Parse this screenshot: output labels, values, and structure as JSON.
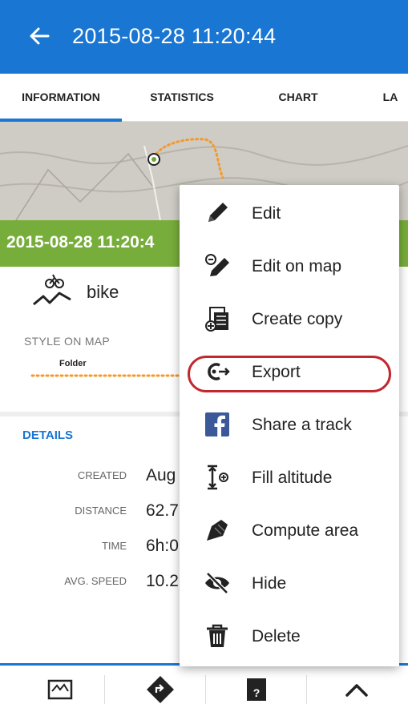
{
  "appbar": {
    "title": "2015-08-28 11:20:44"
  },
  "tabs": [
    {
      "label": "INFORMATION"
    },
    {
      "label": "STATISTICS"
    },
    {
      "label": "CHART"
    },
    {
      "label": "LA"
    }
  ],
  "track": {
    "name_banner": "2015-08-28 11:20:4"
  },
  "activity": {
    "label": "bike"
  },
  "style": {
    "label": "STYLE ON MAP",
    "folder": "Folder",
    "line_color": "#f39a2e"
  },
  "details": {
    "heading": "DETAILS",
    "rows": [
      {
        "key": "CREATED",
        "value": "Aug"
      },
      {
        "key": "DISTANCE",
        "value": "62.7"
      },
      {
        "key": "TIME",
        "value": "6h:0"
      },
      {
        "key": "AVG. SPEED",
        "value": "10.2"
      }
    ]
  },
  "menu": {
    "items": [
      {
        "label": "Edit",
        "icon": "pencil-icon"
      },
      {
        "label": "Edit on map",
        "icon": "edit-on-map-icon"
      },
      {
        "label": "Create copy",
        "icon": "copy-icon"
      },
      {
        "label": "Export",
        "icon": "export-icon"
      },
      {
        "label": "Share a track",
        "icon": "facebook-icon"
      },
      {
        "label": "Fill altitude",
        "icon": "altitude-icon"
      },
      {
        "label": "Compute area",
        "icon": "area-icon"
      },
      {
        "label": "Hide",
        "icon": "hide-icon"
      },
      {
        "label": "Delete",
        "icon": "trash-icon"
      }
    ],
    "highlighted": "Export"
  },
  "bottombar": {
    "items": [
      "map-icon",
      "navigate-icon",
      "route-planner-icon",
      "chevron-up-icon"
    ]
  },
  "colors": {
    "primary": "#1976d2",
    "banner": "#77ad3a",
    "highlight": "#c0282e"
  }
}
